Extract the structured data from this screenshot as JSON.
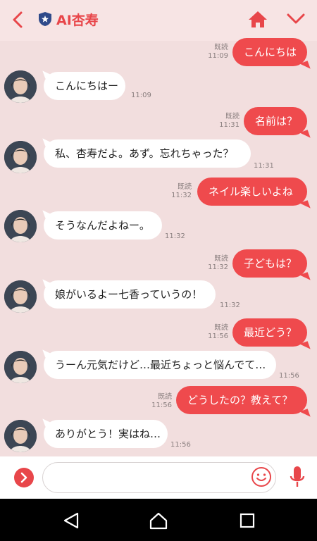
{
  "header": {
    "title": "AI杏寿",
    "back_icon": "chevron-left-icon",
    "home_icon": "home-icon",
    "menu_icon": "chevron-down-icon",
    "accent": "#e8464a"
  },
  "messages": [
    {
      "dir": "out",
      "text": "こんにちは",
      "read": "既読",
      "time": "11:09"
    },
    {
      "dir": "in",
      "text": "こんにちはー",
      "time": "11:09"
    },
    {
      "dir": "out",
      "text": "名前は？",
      "read": "既読",
      "time": "11:31"
    },
    {
      "dir": "in",
      "text": "私、杏寿だよ。あず。忘れちゃった？",
      "time": "11:31"
    },
    {
      "dir": "out",
      "text": "ネイル楽しいよね",
      "read": "既読",
      "time": "11:32"
    },
    {
      "dir": "in",
      "text": "そうなんだよねー。",
      "time": "11:32"
    },
    {
      "dir": "out",
      "text": "子どもは？",
      "read": "既読",
      "time": "11:32"
    },
    {
      "dir": "in",
      "text": "娘がいるよー七香っていうの！",
      "time": "11:32"
    },
    {
      "dir": "out",
      "text": "最近どう？",
      "read": "既読",
      "time": "11:56"
    },
    {
      "dir": "in",
      "text": "うーん元気だけど…最近ちょっと悩んでて…",
      "time": "11:56"
    },
    {
      "dir": "out",
      "text": "どうしたの？教えて？",
      "read": "既読",
      "time": "11:56"
    },
    {
      "dir": "in",
      "text": "ありがとう！実はね…",
      "time": "11:56"
    }
  ],
  "colors": {
    "background": "#f2dede",
    "outgoing_bubble": "#ef4a4d",
    "incoming_bubble": "#ffffff"
  }
}
